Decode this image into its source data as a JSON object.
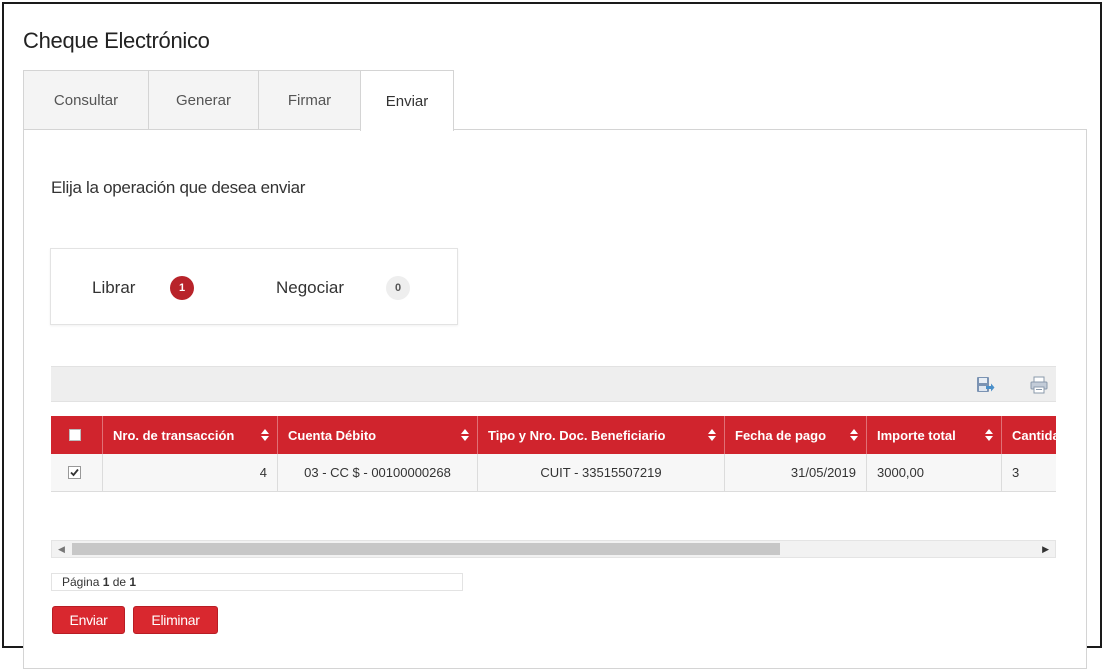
{
  "page": {
    "title": "Cheque Electrónico",
    "subtitle": "Elija la operación que desea enviar"
  },
  "tabs": [
    "Consultar",
    "Generar",
    "Firmar",
    "Enviar"
  ],
  "active_tab": "Enviar",
  "operations": [
    {
      "label": "Librar",
      "count": "1"
    },
    {
      "label": "Negociar",
      "count": "0"
    }
  ],
  "toolbar": {
    "icons": [
      "export-icon",
      "print-icon"
    ]
  },
  "table": {
    "columns": [
      "Nro. de transacción",
      "Cuenta Débito",
      "Tipo y Nro. Doc. Beneficiario",
      "Fecha de pago",
      "Importe total",
      "Cantida"
    ],
    "rows": [
      {
        "checked": true,
        "cells": [
          "4",
          "03 - CC $ - 00100000268",
          "CUIT - 33515507219",
          "31/05/2019",
          "3000,00",
          "3"
        ]
      }
    ]
  },
  "pager": {
    "prefix": "Página ",
    "current": "1",
    "middle": " de ",
    "total": "1"
  },
  "actions": {
    "send": "Enviar",
    "delete": "Eliminar"
  },
  "colors": {
    "accent": "#d0242d",
    "badge_active": "#b8232a",
    "badge_inactive": "#eeeeee"
  }
}
